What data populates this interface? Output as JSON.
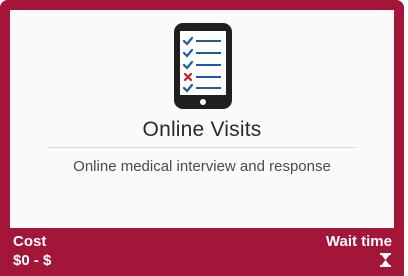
{
  "card": {
    "title": "Online Visits",
    "description": "Online medical interview and response",
    "icon": "phone-checklist-icon"
  },
  "footer": {
    "cost_label": "Cost",
    "cost_value": "$0 - $",
    "wait_label": "Wait time",
    "wait_icon": "hourglass-icon"
  },
  "colors": {
    "brand": "#a3163a",
    "check": "#1e5aa8",
    "cross": "#cc1f2f",
    "text": "#2a2a2a"
  }
}
